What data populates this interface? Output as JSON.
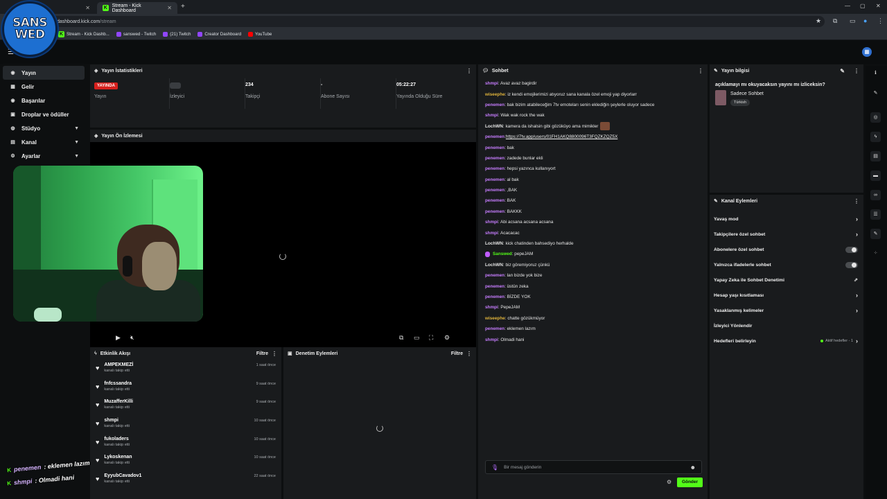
{
  "browser": {
    "tabs": [
      {
        "label": "",
        "active": false
      },
      {
        "label": "Stream - Kick Dashboard",
        "active": true
      }
    ],
    "url_host": "dashboard.kick.com",
    "url_path": "/stream",
    "bookmarks": [
      "Stream - Kick Dashb...",
      "sanswed - Twitch",
      "(21) Twitch",
      "Creator Dashboard",
      "YouTube"
    ]
  },
  "logo": {
    "line1": "SANS",
    "line2": "WED"
  },
  "nav": [
    {
      "label": "Yayın",
      "icon": "broadcast-icon",
      "active": true,
      "expandable": false
    },
    {
      "label": "Gelir",
      "icon": "income-icon",
      "active": false,
      "expandable": false
    },
    {
      "label": "Başarılar",
      "icon": "achievements-icon",
      "active": false,
      "expandable": false
    },
    {
      "label": "Droplar ve ödüller",
      "icon": "gift-icon",
      "active": false,
      "expandable": false
    },
    {
      "label": "Stüdyo",
      "icon": "studio-icon",
      "active": false,
      "expandable": true
    },
    {
      "label": "Kanal",
      "icon": "channel-icon",
      "active": false,
      "expandable": true
    },
    {
      "label": "Ayarlar",
      "icon": "gear-icon",
      "active": false,
      "expandable": true
    }
  ],
  "stats": {
    "title": "Yayın İstatistikleri",
    "items": [
      {
        "value": "YAYINDA",
        "label": "Yayın"
      },
      {
        "value": "",
        "label": "İzleyici"
      },
      {
        "value": "234",
        "label": "Takipçi"
      },
      {
        "value": "-",
        "label": "Abone Sayısı"
      },
      {
        "value": "05:22:27",
        "label": "Yayında Olduğu Süre"
      }
    ]
  },
  "preview": {
    "title": "Yayın Ön İzlemesi"
  },
  "activity": {
    "title": "Etkinlik Akışı",
    "filter": "Filtre",
    "items": [
      {
        "name": "AMPEKMEZİ",
        "sub": "kanalı takip etti",
        "time": "1 saat önce"
      },
      {
        "name": "fnfcssandra",
        "sub": "kanalı takip etti",
        "time": "9 saat önce"
      },
      {
        "name": "MuzafferKilli",
        "sub": "kanalı takip etti",
        "time": "9 saat önce"
      },
      {
        "name": "shmpi",
        "sub": "kanalı takip etti",
        "time": "10 saat önce"
      },
      {
        "name": "fukoladers",
        "sub": "kanalı takip etti",
        "time": "10 saat önce"
      },
      {
        "name": "Lykoskenan",
        "sub": "kanalı takip etti",
        "time": "10 saat önce"
      },
      {
        "name": "EyyubCavadov1",
        "sub": "kanalı takip etti",
        "time": "22 saat önce"
      }
    ]
  },
  "moderation": {
    "title": "Denetim Eylemleri",
    "filter": "Filtre"
  },
  "chat": {
    "title": "Sohbet",
    "messages": [
      {
        "user": "shmpi",
        "color": "#c77dff",
        "text": ": Avaz avaz bagirdir"
      },
      {
        "user": "wiseephe",
        "color": "#e0b43c",
        "text": ": iz kendi emojilerimizi atıyoruz sana kanala özel emoji yap diyorlarr"
      },
      {
        "user": "penemen",
        "color": "#c77dff",
        "text": ": bak bizim atabileceğim 7tv emoteları senin eklediğin şeylerle oluyor sadece"
      },
      {
        "user": "shmpi",
        "color": "#c77dff",
        "text": ": Wak wak rock the wak"
      },
      {
        "user": "LochWN",
        "color": "#e6e6e6",
        "text": ": kamera da ishalsin gibi gözüküyo ama mimikler"
      },
      {
        "user": "penemen",
        "color": "#c77dff",
        "text": ": ",
        "link": "https://7tv.app/users/01FH1AKQ8800096T3FQZKZQZ5X"
      },
      {
        "user": "penemen",
        "color": "#c77dff",
        "text": ": bak"
      },
      {
        "user": "penemen",
        "color": "#c77dff",
        "text": ": zadede bunlar ekli"
      },
      {
        "user": "penemen",
        "color": "#c77dff",
        "text": ": hepsi yazınca kullanıyort"
      },
      {
        "user": "penemen",
        "color": "#c77dff",
        "text": ": al bak"
      },
      {
        "user": "penemen",
        "color": "#c77dff",
        "text": ": ,BAK"
      },
      {
        "user": "penemen",
        "color": "#c77dff",
        "text": ": BAK"
      },
      {
        "user": "penemen",
        "color": "#c77dff",
        "text": ": BAKKK"
      },
      {
        "user": "shmpi",
        "color": "#c77dff",
        "text": ": Abi acsana acsana acsana"
      },
      {
        "user": "shmpi",
        "color": "#c77dff",
        "text": ": Acacacac"
      },
      {
        "user": "LochWN",
        "color": "#e6e6e6",
        "text": ": kick chatinden bahsediyo herhalde"
      },
      {
        "user": "Sanswed",
        "color": "#53fc18",
        "text": ": pepeJAM",
        "badge": true
      },
      {
        "user": "LochWN",
        "color": "#e6e6e6",
        "text": ": biz göremiyoruz çünkü"
      },
      {
        "user": "penemen",
        "color": "#c77dff",
        "text": ": lan bizde yok bize"
      },
      {
        "user": "penemen",
        "color": "#c77dff",
        "text": ": üstün zeka"
      },
      {
        "user": "penemen",
        "color": "#c77dff",
        "text": ": BİZDE YOK"
      },
      {
        "user": "shmpi",
        "color": "#c77dff",
        "text": ": PepeJAM"
      },
      {
        "user": "wiseephe",
        "color": "#e0b43c",
        "text": ": chatte gözükmüyor"
      },
      {
        "user": "penemen",
        "color": "#c77dff",
        "text": ": eklemen lazım"
      },
      {
        "user": "shmpi",
        "color": "#c77dff",
        "text": ": Olmadi hani"
      }
    ],
    "input_placeholder": "Bir mesaj gönderin",
    "send_label": "Gönder"
  },
  "stream_info": {
    "title": "Yayın bilgisi",
    "stream_title": "açıklamayı mı okuyacaksın yayını mı izliceksin?",
    "mode": "Sadece Sohbet",
    "language": "Türkish"
  },
  "channel_actions": {
    "title": "Kanal Eylemleri",
    "items": [
      {
        "label": "Yavaş mod",
        "control": "chevron"
      },
      {
        "label": "Takipçilere özel sohbet",
        "control": "chevron"
      },
      {
        "label": "Abonelere özel sohbet",
        "control": "toggle"
      },
      {
        "label": "Yalnızca ifadelerle sohbet",
        "control": "toggle"
      },
      {
        "label": "Yapay Zeka ile Sohbet Denetimi",
        "control": "external"
      },
      {
        "label": "Hesap yaşı kısıtlaması",
        "control": "chevron"
      },
      {
        "label": "Yasaklanmış kelimeler",
        "control": "chevron"
      },
      {
        "label": "İzleyici Yönlendir",
        "control": "none"
      },
      {
        "label": "Hedefleri belirleyin",
        "control": "goal",
        "tag": "Aktif hedefler - 1"
      }
    ]
  },
  "overlay": [
    {
      "user": "penemen",
      "text": ": eklemen lazım"
    },
    {
      "user": "shmpi",
      "text": ": Olmadi hani"
    }
  ],
  "colors": {
    "accent": "#53fc18",
    "live": "#d6201d",
    "username_purple": "#c77dff",
    "username_gold": "#e0b43c"
  }
}
